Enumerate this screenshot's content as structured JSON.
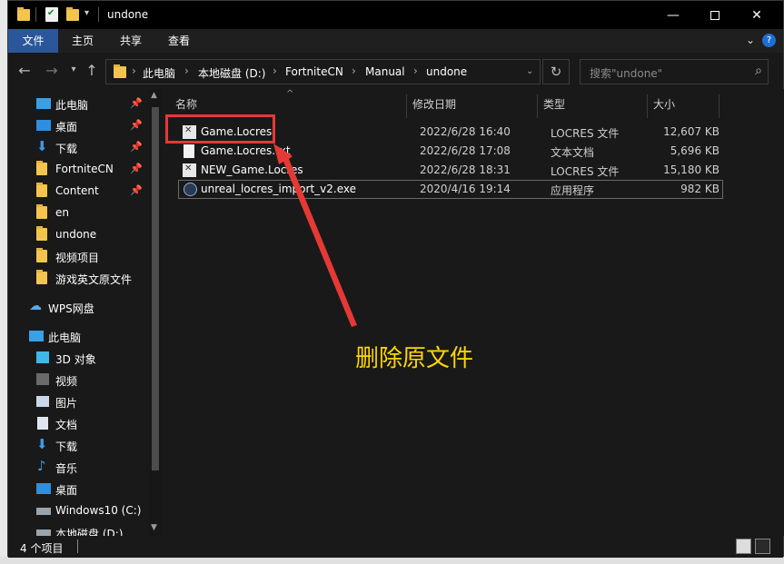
{
  "window": {
    "title": "undone"
  },
  "ribbon": {
    "tabs": [
      {
        "label": "文件",
        "active": true
      },
      {
        "label": "主页",
        "active": false
      },
      {
        "label": "共享",
        "active": false
      },
      {
        "label": "查看",
        "active": false
      }
    ]
  },
  "address": {
    "crumbs": [
      "此电脑",
      "本地磁盘 (D:)",
      "FortniteCN",
      "Manual",
      "undone"
    ]
  },
  "search": {
    "placeholder": "搜索\"undone\""
  },
  "nav": {
    "quick_access": [
      {
        "label": "此电脑",
        "icon": "pc-icon",
        "pinned": true
      },
      {
        "label": "桌面",
        "icon": "desktop-icon",
        "pinned": true
      },
      {
        "label": "下载",
        "icon": "download-icon",
        "pinned": true
      },
      {
        "label": "FortniteCN",
        "icon": "folder-icon",
        "pinned": true
      },
      {
        "label": "Content",
        "icon": "folder-icon",
        "pinned": true
      },
      {
        "label": "en",
        "icon": "folder-icon",
        "pinned": false
      },
      {
        "label": "undone",
        "icon": "folder-icon",
        "pinned": false
      },
      {
        "label": "视频项目",
        "icon": "folder-icon",
        "pinned": false
      },
      {
        "label": "游戏英文原文件",
        "icon": "folder-icon",
        "pinned": false
      }
    ],
    "wps": {
      "label": "WPS网盘",
      "icon": "cloud-icon"
    },
    "this_pc": {
      "label": "此电脑",
      "items": [
        {
          "label": "3D 对象",
          "icon": "3d-objects-icon"
        },
        {
          "label": "视频",
          "icon": "video-icon"
        },
        {
          "label": "图片",
          "icon": "pictures-icon"
        },
        {
          "label": "文档",
          "icon": "documents-icon"
        },
        {
          "label": "下载",
          "icon": "download-icon"
        },
        {
          "label": "音乐",
          "icon": "music-icon"
        },
        {
          "label": "桌面",
          "icon": "desktop-icon"
        },
        {
          "label": "Windows10 (C:)",
          "icon": "drive-icon"
        },
        {
          "label": "本地磁盘 (D:)",
          "icon": "drive-icon"
        }
      ]
    }
  },
  "columns": {
    "name": "名称",
    "modified": "修改日期",
    "type": "类型",
    "size": "大小"
  },
  "files": [
    {
      "name": "Game.Locres",
      "modified": "2022/6/28 16:40",
      "type": "LOCRES 文件",
      "size": "12,607 KB",
      "icon": "locres-file-icon"
    },
    {
      "name": "Game.Locres.txt",
      "modified": "2022/6/28 17:08",
      "type": "文本文档",
      "size": "5,696 KB",
      "icon": "text-file-icon"
    },
    {
      "name": "NEW_Game.Locres",
      "modified": "2022/6/28 18:31",
      "type": "LOCRES 文件",
      "size": "15,180 KB",
      "icon": "locres-file-icon"
    },
    {
      "name": "unreal_locres_import_v2.exe",
      "modified": "2020/4/16 19:14",
      "type": "应用程序",
      "size": "982 KB",
      "icon": "exe-file-icon"
    }
  ],
  "status": {
    "count": "4 个项目"
  },
  "annotation": {
    "text": "删除原文件",
    "color": "#ffd600",
    "box_color": "#e53935"
  },
  "colors": {
    "accent": "#2b579a",
    "background": "#191919"
  }
}
